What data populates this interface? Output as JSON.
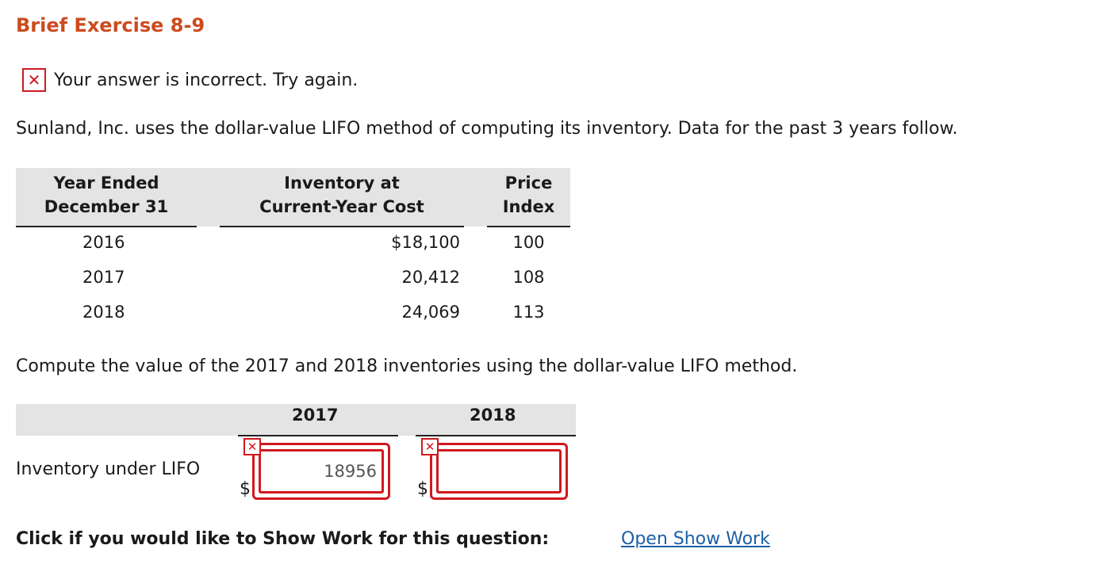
{
  "title": "Brief Exercise 8-9",
  "status": {
    "icon": "x-mark-icon",
    "message": "Your answer is incorrect.  Try again."
  },
  "intro": "Sunland, Inc. uses the dollar-value LIFO method of computing its inventory. Data for the past 3 years follow.",
  "data_table": {
    "headers": {
      "year": [
        "Year Ended",
        "December 31"
      ],
      "inventory": [
        "Inventory at",
        "Current-Year Cost"
      ],
      "price": [
        "Price",
        "Index"
      ]
    },
    "rows": [
      {
        "year": "2016",
        "inventory": "$18,100",
        "price": "100"
      },
      {
        "year": "2017",
        "inventory": "20,412",
        "price": "108"
      },
      {
        "year": "2018",
        "inventory": "24,069",
        "price": "113"
      }
    ]
  },
  "compute_prompt": "Compute the value of the 2017 and 2018 inventories using the dollar-value LIFO method.",
  "answer_table": {
    "columns": [
      "2017",
      "2018"
    ],
    "row_label": "Inventory under LIFO",
    "currency_symbol": "$",
    "inputs": [
      {
        "value": "18956",
        "status": "incorrect"
      },
      {
        "value": "",
        "status": "incorrect"
      }
    ]
  },
  "show_work": {
    "prompt": "Click if you would like to Show Work for this question:",
    "link_label": "Open Show Work"
  },
  "colors": {
    "title": "#cc4b1f",
    "error": "#d0191f",
    "link": "#1b5fa6",
    "header_bg": "#e4e4e4"
  }
}
